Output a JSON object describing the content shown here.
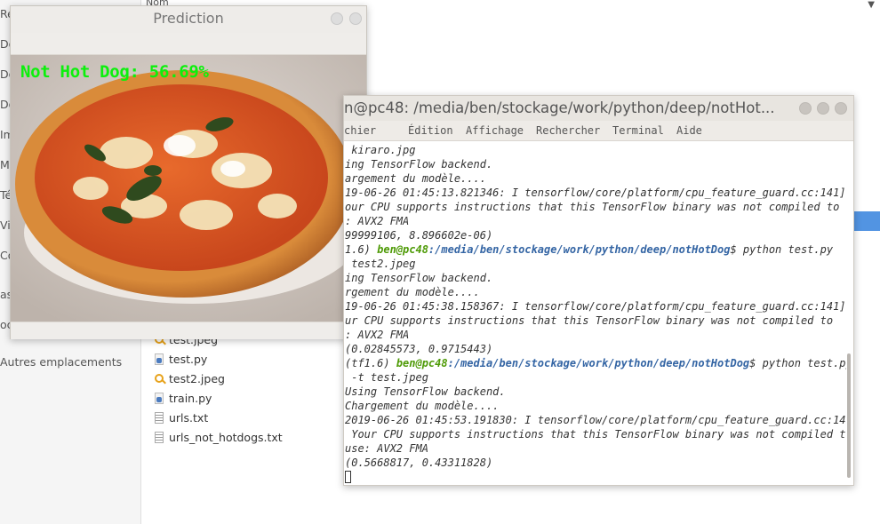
{
  "file_manager": {
    "column_header": "Nom",
    "sidebar": [
      {
        "label": "Ré"
      },
      {
        "label": "Do"
      },
      {
        "label": "Do"
      },
      {
        "label": "Do"
      },
      {
        "label": "Im"
      },
      {
        "label": "Mu"
      },
      {
        "label": "Té"
      },
      {
        "label": "Vi"
      },
      {
        "label": "Co"
      },
      {
        "label": "as"
      },
      {
        "label": "oc"
      },
      {
        "label": "Autres emplacements"
      }
    ],
    "files": [
      {
        "name": "test.jpeg",
        "icon": "image-file-icon"
      },
      {
        "name": "test.py",
        "icon": "python-file-icon"
      },
      {
        "name": "test2.jpeg",
        "icon": "image-file-icon"
      },
      {
        "name": "train.py",
        "icon": "python-file-icon"
      },
      {
        "name": "urls.txt",
        "icon": "text-file-icon"
      },
      {
        "name": "urls_not_hotdogs.txt",
        "icon": "text-file-icon"
      }
    ],
    "accent_color": "#5294e2"
  },
  "prediction_window": {
    "title": "Prediction",
    "label": "Not Hot Dog: 56.69%",
    "label_color": "#0cf00c"
  },
  "terminal": {
    "title": "n@pc48: /media/ben/stockage/work/python/deep/notHot...",
    "menu": [
      "chier",
      "Édition",
      "Affichage",
      "Rechercher",
      "Terminal",
      "Aide"
    ],
    "lines": [
      {
        "text": " kiraro.jpg"
      },
      {
        "text": "ing TensorFlow backend."
      },
      {
        "text": "argement du modèle...."
      },
      {
        "text": "19-06-26 01:45:13.821346: I tensorflow/core/platform/cpu_feature_guard.cc:141]"
      },
      {
        "text": "our CPU supports instructions that this TensorFlow binary was not compiled to"
      },
      {
        "text": ": AVX2 FMA"
      },
      {
        "text": "99999106, 8.896602e-06)"
      },
      {
        "prefix": "1.6) ",
        "user": "ben@pc48",
        "path": ":/media/ben/stockage/work/python/deep/notHotDog",
        "cmd": "$ python test.py"
      },
      {
        "text": " test2.jpeg"
      },
      {
        "text": "ing TensorFlow backend."
      },
      {
        "text": "rgement du modèle...."
      },
      {
        "text": "19-06-26 01:45:38.158367: I tensorflow/core/platform/cpu_feature_guard.cc:141]"
      },
      {
        "text": "ur CPU supports instructions that this TensorFlow binary was not compiled to"
      },
      {
        "text": ": AVX2 FMA"
      },
      {
        "text": "(0.02845573, 0.9715443)"
      },
      {
        "prefix": "(tf1.6) ",
        "user": "ben@pc48",
        "path": ":/media/ben/stockage/work/python/deep/notHotDog",
        "cmd": "$ python test.py"
      },
      {
        "text": " -t test.jpeg"
      },
      {
        "text": "Using TensorFlow backend."
      },
      {
        "text": "Chargement du modèle...."
      },
      {
        "text": "2019-06-26 01:45:53.191830: I tensorflow/core/platform/cpu_feature_guard.cc:141]"
      },
      {
        "text": " Your CPU supports instructions that this TensorFlow binary was not compiled to"
      },
      {
        "text": "use: AVX2 FMA"
      },
      {
        "text": "(0.5668817, 0.43311828)"
      }
    ]
  }
}
